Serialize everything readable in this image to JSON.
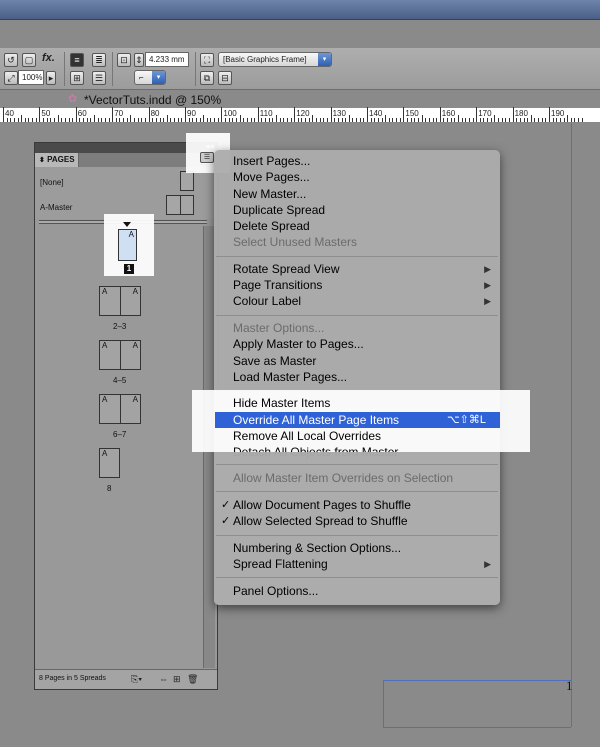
{
  "toolbar": {
    "fx_label": "fx.",
    "zoom_field": "100%",
    "stroke_weight": "4.233 mm",
    "frame_style": "[Basic Graphics Frame]"
  },
  "document": {
    "tab_title": "*VectorTuts.indd @ 150%"
  },
  "ruler": {
    "labels": [
      "40",
      "50",
      "60",
      "70",
      "80",
      "90",
      "100",
      "110",
      "120",
      "130",
      "140",
      "150",
      "160",
      "170",
      "180",
      "190"
    ]
  },
  "canvas": {
    "page_number": "1"
  },
  "pages_panel": {
    "tab_label": "PAGES",
    "masters": [
      {
        "label": "[None]"
      },
      {
        "label": "A-Master"
      }
    ],
    "page_letter": "A",
    "first_page_badge": "1",
    "spreads": [
      {
        "label": "2–3"
      },
      {
        "label": "4–5"
      },
      {
        "label": "6–7"
      },
      {
        "label": "8"
      }
    ],
    "footer_status": "8 Pages in 5 Spreads"
  },
  "menu": {
    "items": [
      {
        "label": "Insert Pages..."
      },
      {
        "label": "Move Pages..."
      },
      {
        "label": "New Master..."
      },
      {
        "label": "Duplicate Spread"
      },
      {
        "label": "Delete Spread"
      },
      {
        "label": "Select Unused Masters"
      },
      {
        "label": "Rotate Spread View"
      },
      {
        "label": "Page Transitions"
      },
      {
        "label": "Colour Label"
      },
      {
        "label": "Master Options..."
      },
      {
        "label": "Apply Master to Pages..."
      },
      {
        "label": "Save as Master"
      },
      {
        "label": "Load Master Pages..."
      },
      {
        "label": "Hide Master Items"
      },
      {
        "label": "Override All Master Page Items",
        "shortcut": "⌥⇧⌘L"
      },
      {
        "label": "Remove All Local Overrides"
      },
      {
        "label": "Detach All Objects from Master"
      },
      {
        "label": "Allow Master Item Overrides on Selection"
      },
      {
        "label": "Allow Document Pages to Shuffle"
      },
      {
        "label": "Allow Selected Spread to Shuffle"
      },
      {
        "label": "Numbering & Section Options..."
      },
      {
        "label": "Spread Flattening"
      },
      {
        "label": "Panel Options..."
      }
    ],
    "submenu_glyph": "▶",
    "check_glyph": "✓",
    "highlight_color": "#2f62d6"
  }
}
